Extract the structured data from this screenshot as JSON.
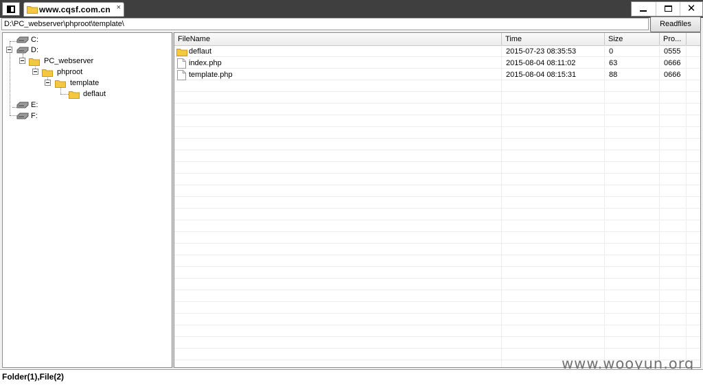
{
  "tab": {
    "title": "www.cqsf.com.cn",
    "close": "×"
  },
  "window": {
    "minimize_icon": "minimize-icon",
    "maximize_icon": "maximize-icon",
    "close_label": "✕"
  },
  "pathbar": {
    "value": "D:\\PC_webserver\\phproot\\template\\",
    "button": "Readfiles"
  },
  "tree": {
    "drives": [
      "C:",
      "D:",
      "E:",
      "F:"
    ],
    "folders": [
      "PC_webserver",
      "phproot",
      "template",
      "deflaut"
    ]
  },
  "list": {
    "columns": [
      "FileName",
      "Time",
      "Size",
      "Pro..."
    ],
    "rows": [
      {
        "name": "deflaut",
        "time": "2015-07-23 08:35:53",
        "size": "0",
        "perm": "0555",
        "icon": "folder-icon"
      },
      {
        "name": "index.php",
        "time": "2015-08-04 08:11:02",
        "size": "63",
        "perm": "0666",
        "icon": "file-icon"
      },
      {
        "name": "template.php",
        "time": "2015-08-04 08:15:31",
        "size": "88",
        "perm": "0666",
        "icon": "file-icon"
      }
    ]
  },
  "status": "Folder(1),File(2)",
  "watermark": "www.wooyun.org",
  "colors": {
    "titlebar": "#3f3f3f",
    "folder": "#f5c842",
    "folder_edge": "#c99a13"
  }
}
